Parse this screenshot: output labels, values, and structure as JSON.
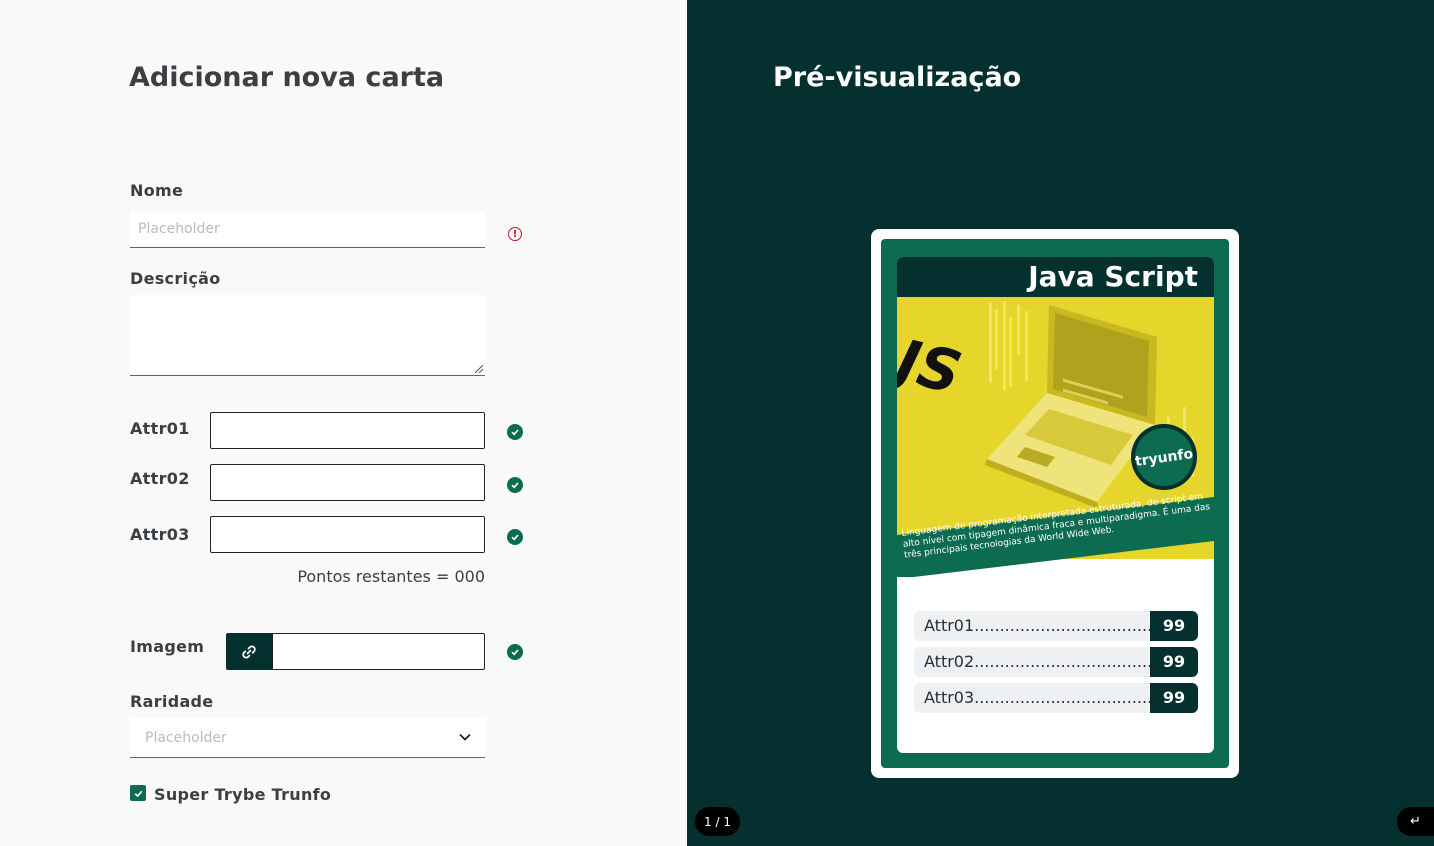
{
  "form": {
    "title": "Adicionar nova carta",
    "name": {
      "label": "Nome",
      "placeholder": "Placeholder",
      "value": ""
    },
    "description": {
      "label": "Descrição",
      "value": ""
    },
    "attrs": [
      {
        "label": "Attr01",
        "value": ""
      },
      {
        "label": "Attr02",
        "value": ""
      },
      {
        "label": "Attr03",
        "value": ""
      }
    ],
    "points_remaining": "Pontos restantes = 000",
    "image": {
      "label": "Imagem",
      "value": ""
    },
    "rarity": {
      "label": "Raridade",
      "placeholder": "Placeholder"
    },
    "super_trunfo": {
      "label": "Super Trybe Trunfo",
      "checked": true
    }
  },
  "preview": {
    "title": "Pré-visualização",
    "card": {
      "name": "Java Script",
      "image_text": "JS",
      "brand": "tryunfo",
      "description": "Linguagem de programação interpretada estruturada, de script em alto nível com tipagem dinâmica fraca e multiparadigma. É uma das três principais tecnologias da World Wide Web.",
      "attrs": [
        {
          "label": "Attr01...................................",
          "value": "99"
        },
        {
          "label": "Attr02...................................",
          "value": "99"
        },
        {
          "label": "Attr03...................................",
          "value": "99"
        }
      ]
    },
    "pager": "1 / 1",
    "back_icon": "↵"
  },
  "colors": {
    "accent": "#0d6b4f",
    "dark": "#043030",
    "error": "#c0152c",
    "card_yellow": "#e6d52a"
  }
}
